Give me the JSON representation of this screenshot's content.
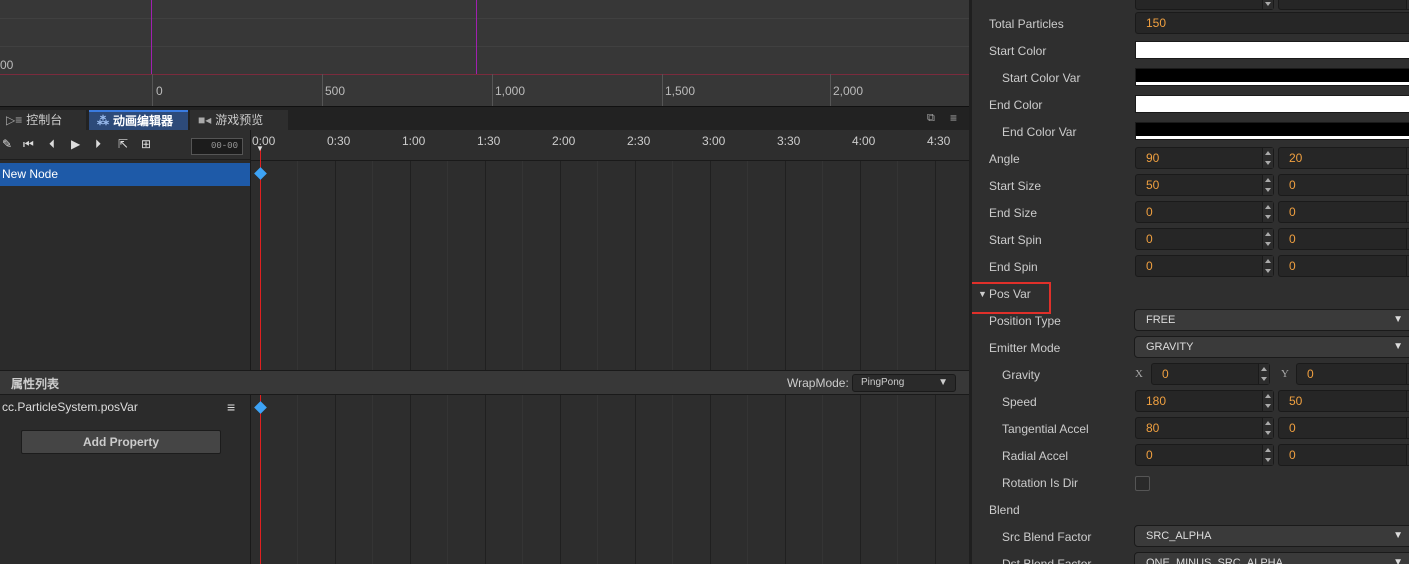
{
  "scene": {
    "tick_labels": [
      "00",
      "0",
      "500",
      "1,000",
      "1,500",
      "2,000"
    ]
  },
  "tabs": {
    "console": "控制台",
    "animation_editor": "动画编辑器",
    "game_preview": "游戏预览"
  },
  "animation": {
    "frame_value": "00-00",
    "node_name": "New Node",
    "time_labels": [
      "0:00",
      "0:30",
      "1:00",
      "1:30",
      "2:00",
      "2:30",
      "3:00",
      "3:30",
      "4:00",
      "4:30"
    ]
  },
  "property_list": {
    "title": "属性列表",
    "wrapmode_label": "WrapMode:",
    "wrapmode_value": "PingPong",
    "property_name": "cc.ParticleSystem.posVar",
    "add_property_label": "Add Property"
  },
  "inspector": {
    "rows": [
      {
        "label": "Total Particles",
        "type": "num1",
        "v1": "150"
      },
      {
        "label": "Start Color",
        "type": "color",
        "color": "#ffffff"
      },
      {
        "label": "Start Color Var",
        "type": "color",
        "color": "#000000",
        "sub": true
      },
      {
        "label": "End Color",
        "type": "color",
        "color": "#ffffff"
      },
      {
        "label": "End Color Var",
        "type": "color",
        "color": "#000000",
        "sub": true
      },
      {
        "label": "Angle",
        "type": "num2",
        "v1": "90",
        "v2": "20"
      },
      {
        "label": "Start Size",
        "type": "num2",
        "v1": "50",
        "v2": "0"
      },
      {
        "label": "End Size",
        "type": "num2",
        "v1": "0",
        "v2": "0"
      },
      {
        "label": "Start Spin",
        "type": "num2",
        "v1": "0",
        "v2": "0"
      },
      {
        "label": "End Spin",
        "type": "num2",
        "v1": "0",
        "v2": "0"
      },
      {
        "label": "Pos Var",
        "type": "section"
      },
      {
        "label": "Position Type",
        "type": "dropdown",
        "value": "FREE"
      },
      {
        "label": "Emitter Mode",
        "type": "dropdown",
        "value": "GRAVITY"
      },
      {
        "label": "Gravity",
        "type": "xy",
        "v1": "0",
        "v2": "0",
        "sub": true,
        "x_label": "X",
        "y_label": "Y"
      },
      {
        "label": "Speed",
        "type": "num2",
        "v1": "180",
        "v2": "50",
        "sub": true
      },
      {
        "label": "Tangential Accel",
        "type": "num2",
        "v1": "80",
        "v2": "0",
        "sub": true
      },
      {
        "label": "Radial Accel",
        "type": "num2",
        "v1": "0",
        "v2": "0",
        "sub": true
      },
      {
        "label": "Rotation Is Dir",
        "type": "checkbox",
        "sub": true
      },
      {
        "label": "Blend",
        "type": "label"
      },
      {
        "label": "Src Blend Factor",
        "type": "dropdown",
        "value": "SRC_ALPHA",
        "sub": true
      },
      {
        "label": "Dst Blend Factor",
        "type": "dropdown",
        "value": "ONE_MINUS_SRC_ALPHA",
        "sub": true
      }
    ]
  },
  "colors": {
    "accent": "#1e5aa8",
    "number": "#f0a040",
    "highlight": "#e0302a",
    "keyframe": "#3da3f5",
    "playhead": "#e02020"
  }
}
